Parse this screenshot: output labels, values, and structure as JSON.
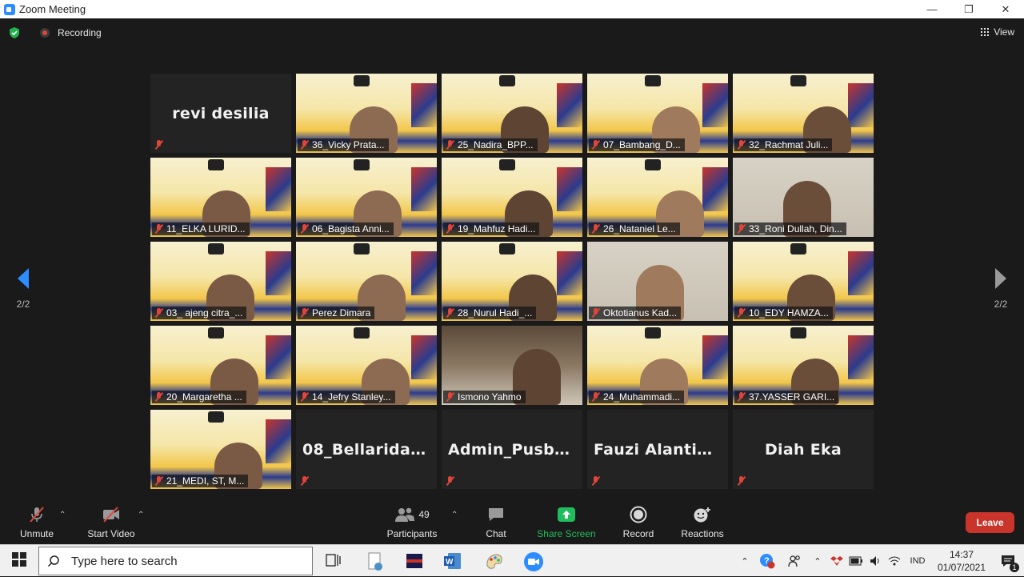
{
  "window": {
    "title": "Zoom Meeting",
    "minimize": "—",
    "restore": "❐",
    "close": "✕"
  },
  "top": {
    "recording_label": "Recording",
    "view_label": "View"
  },
  "pagination": {
    "left_page": "2/2",
    "right_page": "2/2"
  },
  "tiles": [
    {
      "name": "revi desilia",
      "kind": "name"
    },
    {
      "name": "36_Vicky Prata...",
      "kind": "banner"
    },
    {
      "name": "25_Nadira_BPP...",
      "kind": "banner"
    },
    {
      "name": "07_Bambang_D...",
      "kind": "banner"
    },
    {
      "name": "32_Rachmat Juli...",
      "kind": "banner"
    },
    {
      "name": "11_ELKA LURID...",
      "kind": "banner"
    },
    {
      "name": "06_Bagista Anni...",
      "kind": "banner"
    },
    {
      "name": "19_Mahfuz Hadi...",
      "kind": "banner"
    },
    {
      "name": "26_Nataniel Le...",
      "kind": "banner"
    },
    {
      "name": "33_Roni Dullah, Din...",
      "kind": "room"
    },
    {
      "name": "03_ ajeng citra_...",
      "kind": "banner"
    },
    {
      "name": "Perez Dimara",
      "kind": "banner"
    },
    {
      "name": "28_Nurul Hadi_...",
      "kind": "banner"
    },
    {
      "name": "Oktotianus Kad...",
      "kind": "room"
    },
    {
      "name": "10_EDY HAMZA...",
      "kind": "banner"
    },
    {
      "name": "20_Margaretha ...",
      "kind": "banner"
    },
    {
      "name": "14_Jefry Stanley...",
      "kind": "banner"
    },
    {
      "name": "Ismono Yahmo",
      "kind": "room-dark"
    },
    {
      "name": "24_Muhammadi...",
      "kind": "banner"
    },
    {
      "name": "37.YASSER GARI...",
      "kind": "banner"
    },
    {
      "name": "21_MEDI, ST, M...",
      "kind": "banner"
    },
    {
      "name": "08_Bellarida  Fe...",
      "kind": "name"
    },
    {
      "name": "Admin_Pusban...",
      "kind": "name"
    },
    {
      "name": "Fauzi  Alantia  -...",
      "kind": "name"
    },
    {
      "name": "Diah Eka",
      "kind": "name"
    }
  ],
  "toolbar": {
    "unmute": "Unmute",
    "start_video": "Start Video",
    "participants": "Participants",
    "participants_count": "49",
    "chat": "Chat",
    "share_screen": "Share Screen",
    "record": "Record",
    "reactions": "Reactions",
    "leave": "Leave",
    "accent_green": "#1fbd5d",
    "leave_red": "#c9342b"
  },
  "taskbar": {
    "search_placeholder": "Type here to search",
    "language": "IND",
    "time": "14:37",
    "date": "01/07/2021",
    "notification_count": "1"
  }
}
